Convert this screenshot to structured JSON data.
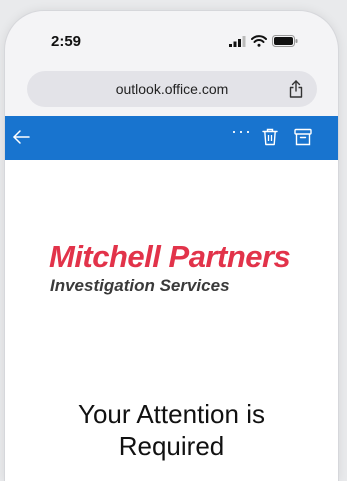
{
  "status_bar": {
    "time": "2:59",
    "icons": [
      "signal-icon",
      "wifi-icon",
      "battery-icon"
    ]
  },
  "browser": {
    "url": "outlook.office.com",
    "share_icon": "share-icon"
  },
  "mail_toolbar": {
    "background_color": "#1874cf",
    "back_icon": "back-arrow-icon",
    "more_label": "···",
    "delete_icon": "trash-icon",
    "archive_icon": "archive-icon"
  },
  "email": {
    "brand_name": "Mitchell Partners",
    "brand_tagline": "Investigation Services",
    "brand_color": "#e2334a",
    "heading_line1": "Your Attention is",
    "heading_line2": "Required"
  }
}
